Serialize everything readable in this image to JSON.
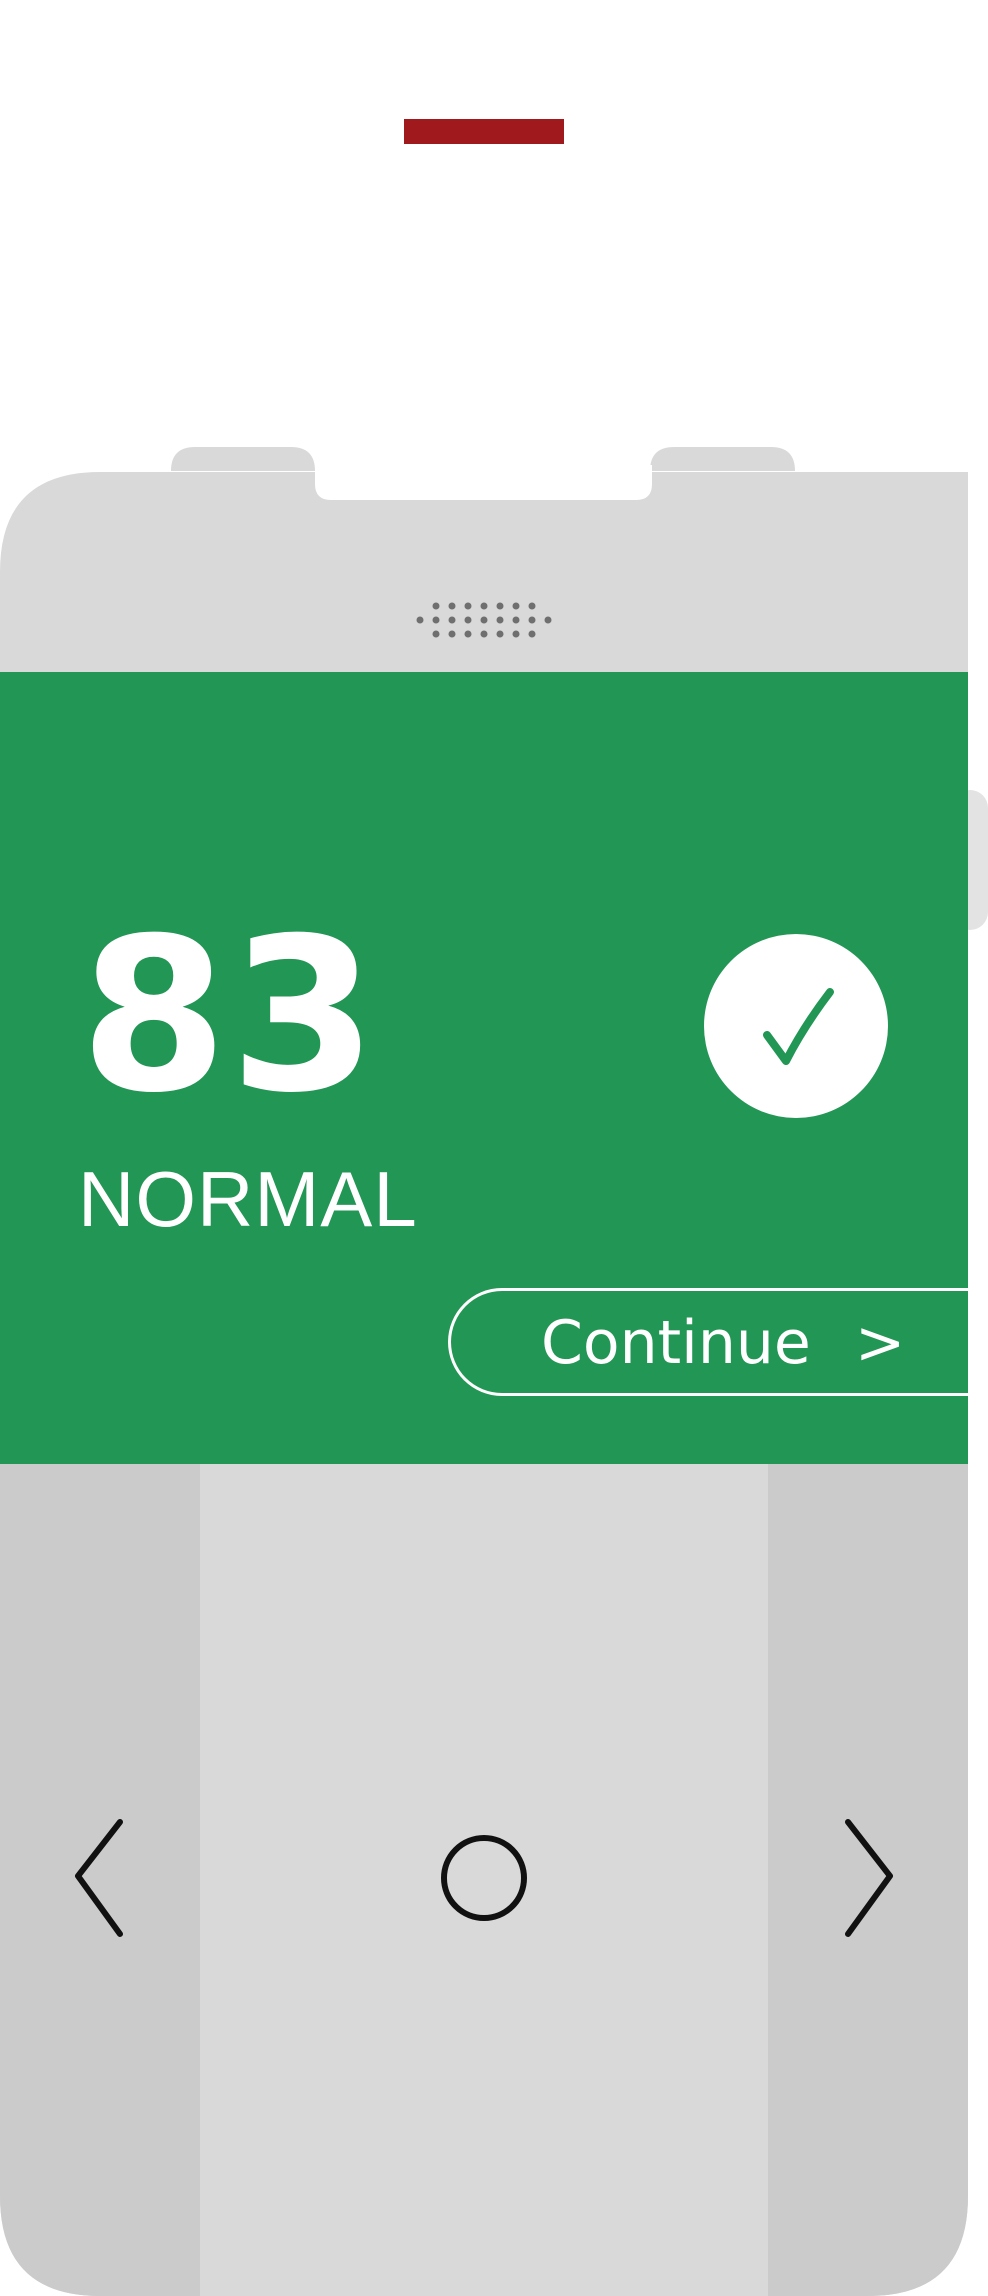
{
  "result": {
    "value": "83",
    "status": "NORMAL"
  },
  "actions": {
    "continue_label": "Continue",
    "continue_arrow": ">"
  },
  "icons": {
    "check": "checkmark-icon",
    "back": "chevron-left-icon",
    "home": "circle-home-icon",
    "forward": "chevron-right-icon",
    "speaker": "speaker-grille-icon"
  },
  "colors": {
    "status_normal": "#229654",
    "indicator": "#a0191c",
    "device_body": "#d9d9d9",
    "device_sides": "#cbcbcb",
    "side_button": "#e3e3e3"
  }
}
